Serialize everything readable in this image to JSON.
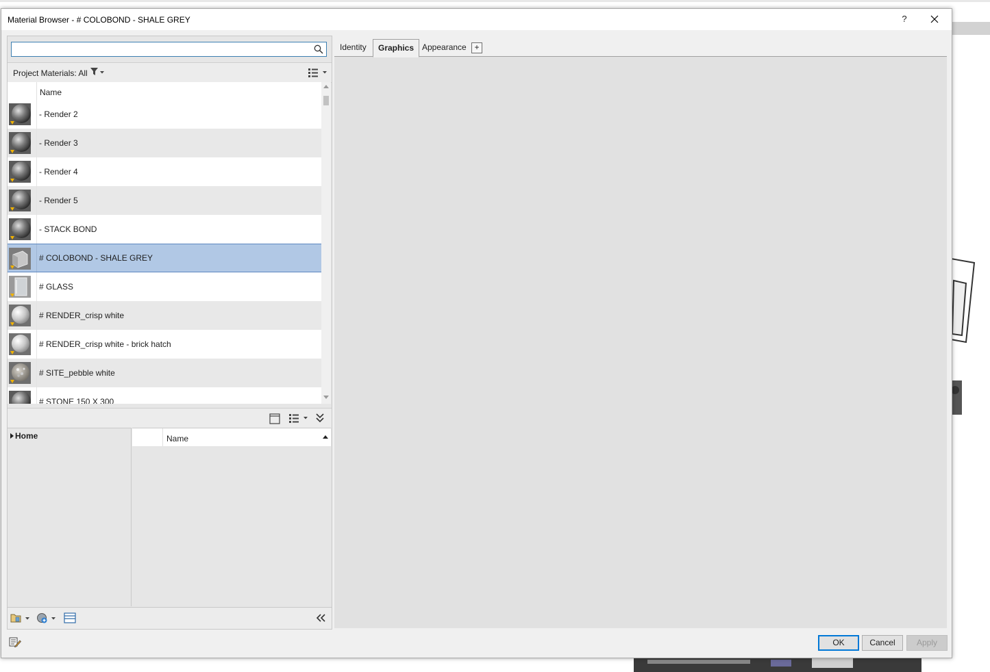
{
  "dialog": {
    "title": "Material Browser - # COLOBOND - SHALE GREY",
    "help_label": "?"
  },
  "search": {
    "value": "",
    "placeholder": ""
  },
  "filter": {
    "label": "Project Materials: All"
  },
  "material_list": {
    "header_name": "Name",
    "items": [
      {
        "label": "- Render 2",
        "icon": "sphere-render-icon"
      },
      {
        "label": "- Render 3",
        "icon": "sphere-render-icon"
      },
      {
        "label": "- Render 4",
        "icon": "sphere-render-icon"
      },
      {
        "label": "- Render 5",
        "icon": "sphere-render-icon"
      },
      {
        "label": "- STACK BOND",
        "icon": "sphere-render-icon"
      },
      {
        "label": "# COLOBOND - SHALE GREY",
        "icon": "cube-metal-icon",
        "selected": true
      },
      {
        "label": "# GLASS",
        "icon": "glass-icon"
      },
      {
        "label": "# RENDER_crisp white",
        "icon": "sphere-white-icon"
      },
      {
        "label": "# RENDER_crisp white - brick hatch",
        "icon": "sphere-white-icon"
      },
      {
        "label": "# SITE_pebble white",
        "icon": "sphere-pebble-icon"
      },
      {
        "label": "# STONE 150 X 300",
        "icon": "sphere-render-icon"
      }
    ]
  },
  "library": {
    "tree_root": "Home",
    "list_header_name": "Name"
  },
  "tabs": [
    {
      "label": "Identity"
    },
    {
      "label": "Graphics",
      "active": true
    },
    {
      "label": "Appearance"
    }
  ],
  "add_tab_label": "+",
  "buttons": {
    "ok": "OK",
    "cancel": "Cancel",
    "apply": "Apply"
  },
  "colors": {
    "selection": "#b1c8e5",
    "accent": "#0078d7",
    "pane_bg": "#e1e1e1"
  }
}
